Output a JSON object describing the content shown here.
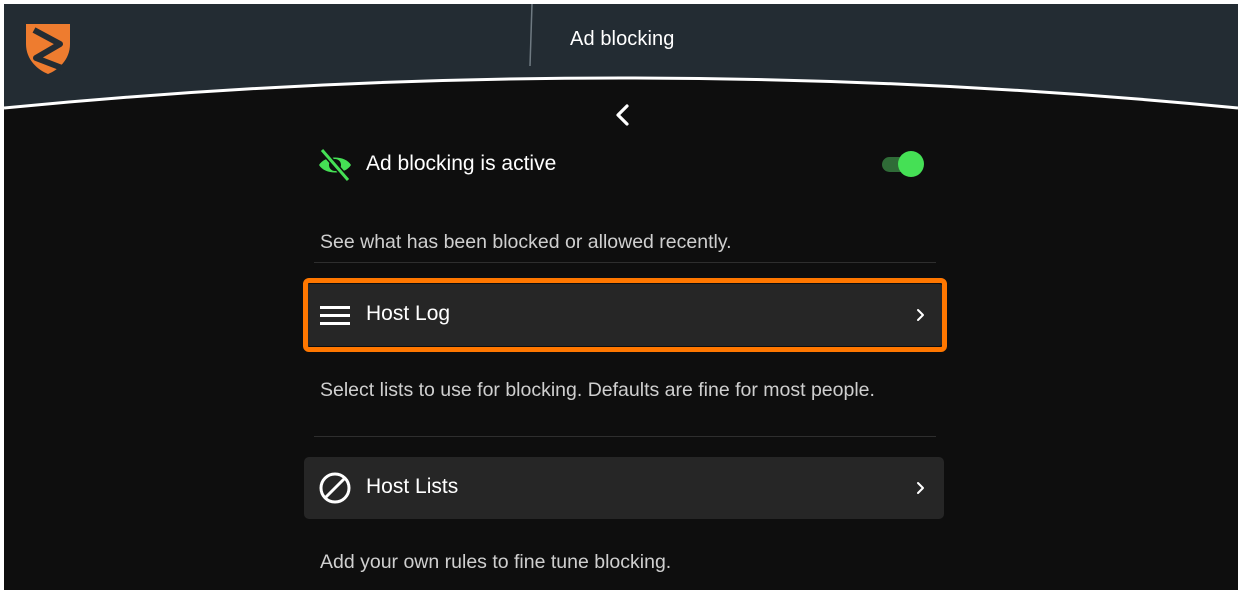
{
  "header": {
    "title": "Ad blocking",
    "logo_icon": "blokada-shield-logo",
    "colors": {
      "bar": "#232c33",
      "logo": "#ee7c2f"
    }
  },
  "back_button": {
    "icon": "chevron-left-icon"
  },
  "status": {
    "label": "Ad blocking is active",
    "icon": "eye-off-icon",
    "toggle_on": true,
    "accent": "#45e055"
  },
  "sections": {
    "host_log_desc": "See what has been blocked or allowed recently.",
    "host_log_label": "Host Log",
    "host_log_icon": "menu-lines-icon",
    "host_lists_desc": "Select lists to use for blocking. Defaults are fine for most people.",
    "host_lists_label": "Host Lists",
    "host_lists_icon": "block-circle-icon",
    "rules_desc": "Add your own rules to fine tune blocking."
  },
  "highlight_color": "#ff7700"
}
